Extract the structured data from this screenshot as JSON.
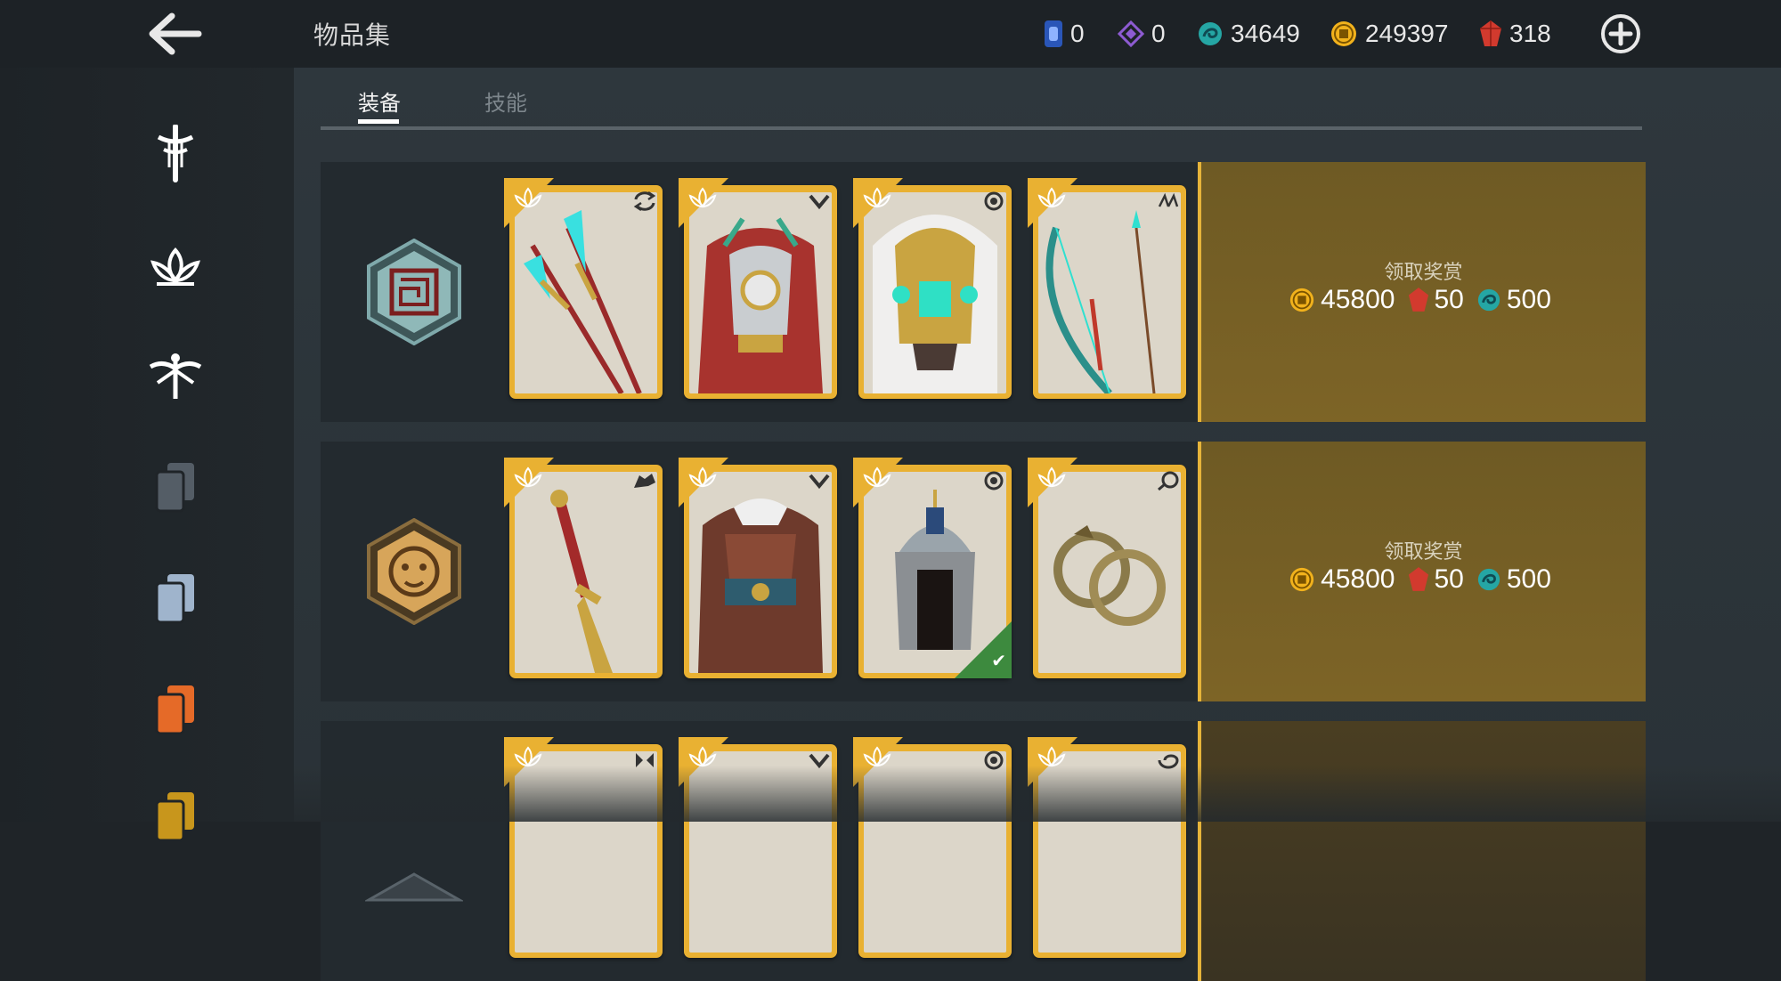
{
  "header": {
    "title": "物品集",
    "currencies": [
      {
        "name": "blue-card",
        "value": "0",
        "color": "#3a6fd8"
      },
      {
        "name": "purple-diamond",
        "value": "0",
        "color": "#8d5bd1"
      },
      {
        "name": "teal-swirl",
        "value": "34649",
        "color": "#25a6a4"
      },
      {
        "name": "gold-coin",
        "value": "249397",
        "color": "#f2b21c"
      },
      {
        "name": "red-gem",
        "value": "318",
        "color": "#d23a2e"
      }
    ],
    "icons": {
      "back": "back-arrow-icon",
      "add": "plus-circle-icon"
    }
  },
  "sidebar": {
    "items": [
      {
        "icon": "sword-emblem-icon",
        "color": "#ffffff"
      },
      {
        "icon": "lotus-icon",
        "color": "#ffffff"
      },
      {
        "icon": "dragonfly-icon",
        "color": "#ffffff"
      },
      {
        "icon": "cards-icon",
        "color": "#545d66"
      },
      {
        "icon": "cards-icon",
        "color": "#9fb4cc"
      },
      {
        "icon": "cards-icon",
        "color": "#e56a28"
      },
      {
        "icon": "cards-icon",
        "color": "#c8961c"
      }
    ]
  },
  "tabs": [
    {
      "label": "装备",
      "active": true
    },
    {
      "label": "技能",
      "active": false
    }
  ],
  "sets": [
    {
      "emblem": "maze-emblem-icon",
      "emblem_color": "#6e9ea0",
      "items": [
        {
          "type_icon": "swap-icon",
          "art": "twin-spears"
        },
        {
          "type_icon": "chevron-down-icon",
          "art": "red-armor"
        },
        {
          "type_icon": "target-icon",
          "art": "gold-helmet"
        },
        {
          "type_icon": "arrows-icon",
          "art": "bow"
        }
      ],
      "reward": {
        "title": "领取奖赏",
        "gold": "45800",
        "gems": "50",
        "steel": "500"
      }
    },
    {
      "emblem": "lion-emblem-icon",
      "emblem_color": "#d7a55a",
      "items": [
        {
          "type_icon": "wolf-icon",
          "art": "dragon-sword",
          "owned": false
        },
        {
          "type_icon": "chevron-down-icon",
          "art": "brown-armor",
          "owned": false
        },
        {
          "type_icon": "target-icon",
          "art": "steel-helmet",
          "owned": true
        },
        {
          "type_icon": "ring-icon",
          "art": "dragon-rings",
          "owned": false
        }
      ],
      "reward": {
        "title": "领取奖赏",
        "gold": "45800",
        "gems": "50",
        "steel": "500"
      }
    },
    {
      "emblem": "partial-emblem-icon",
      "items": [
        {
          "type_icon": "bird-icon"
        },
        {
          "type_icon": "chevron-down-icon"
        },
        {
          "type_icon": "target-icon"
        },
        {
          "type_icon": "spiral-icon"
        }
      ]
    }
  ]
}
